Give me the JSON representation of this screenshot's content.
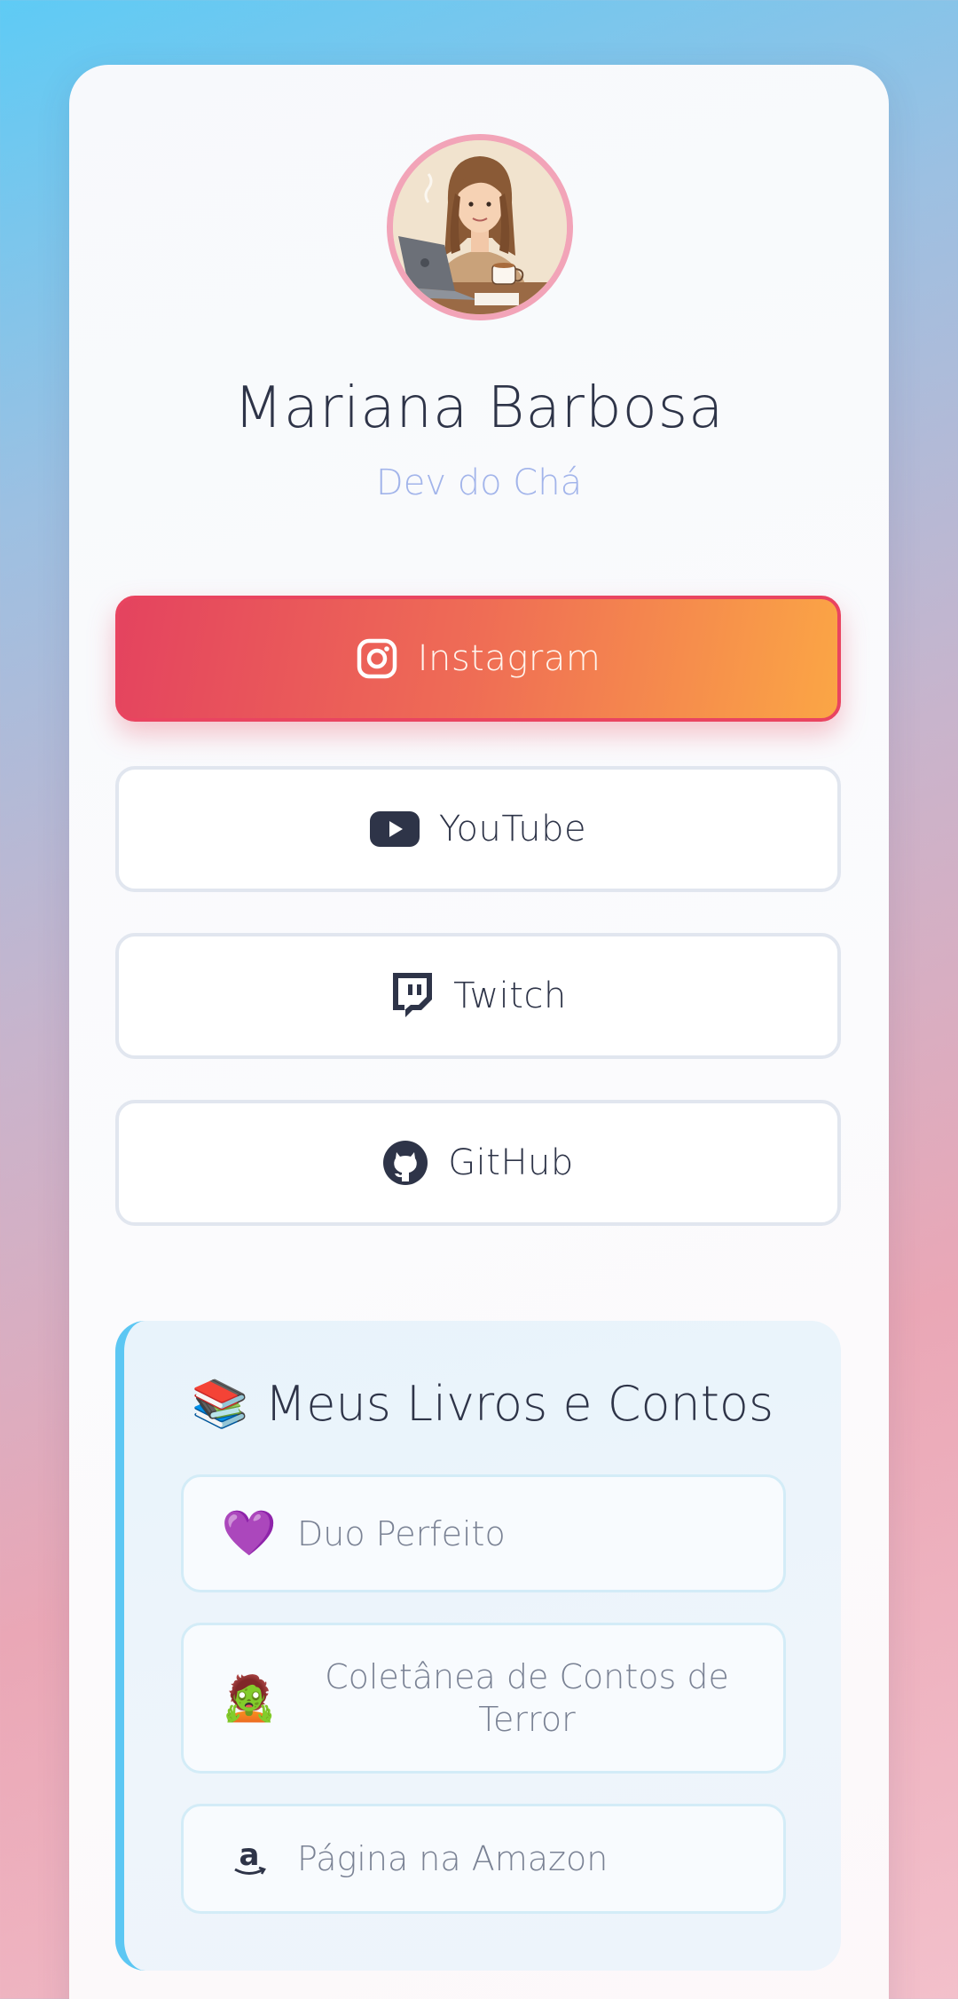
{
  "profile": {
    "name": "Mariana Barbosa",
    "subtitle": "Dev do Chá",
    "avatar_icon": "avatar-illustration"
  },
  "links": {
    "instagram": {
      "label": "Instagram",
      "icon": "instagram-icon"
    },
    "youtube": {
      "label": "YouTube",
      "icon": "youtube-icon"
    },
    "twitch": {
      "label": "Twitch",
      "icon": "twitch-icon"
    },
    "github": {
      "label": "GitHub",
      "icon": "github-icon"
    }
  },
  "books": {
    "title": "Meus Livros e Contos",
    "title_emoji": "📚",
    "items": [
      {
        "emoji": "💜",
        "label": "Duo Perfeito"
      },
      {
        "emoji": "🧟",
        "label": "Coletânea de Contos de Terror"
      },
      {
        "emoji": "a",
        "label": "Página na Amazon"
      }
    ]
  },
  "colors": {
    "instagram_gradient_start": "#e4435f",
    "instagram_gradient_end": "#fba645",
    "accent_border": "#5cc7f3",
    "subtitle": "#a2b4ea",
    "text": "#2e3448"
  }
}
